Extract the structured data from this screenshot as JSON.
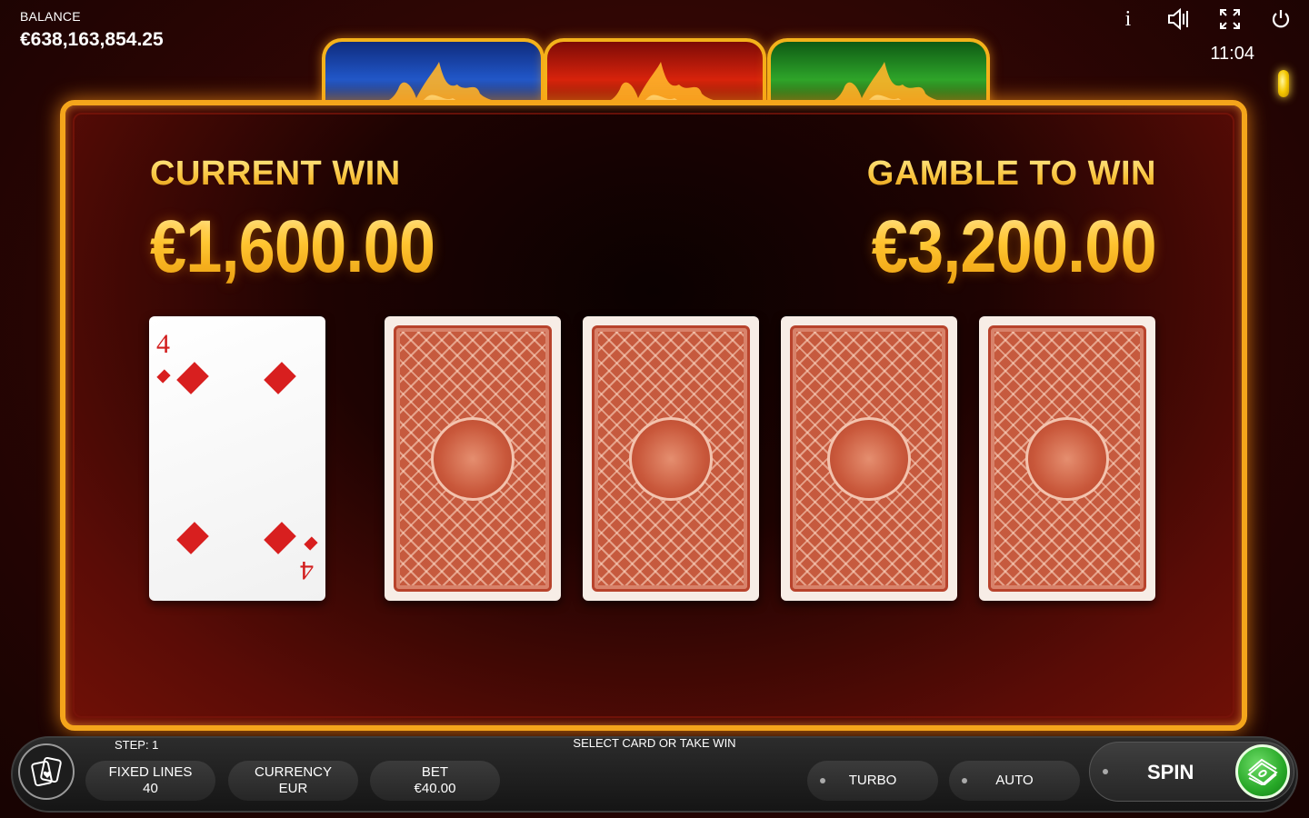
{
  "balance": {
    "label": "BALANCE",
    "value": "€638,163,854.25"
  },
  "topbar": {
    "icons": [
      "info-icon",
      "sound-icon",
      "fullscreen-icon",
      "power-icon"
    ],
    "info_glyph": "i",
    "clock": "11:04"
  },
  "gamble": {
    "current_win_label": "CURRENT WIN",
    "current_win_value": "€1,600.00",
    "gamble_label": "GAMBLE TO WIN",
    "gamble_value": "€3,200.00",
    "dealer_card": {
      "rank": "4",
      "suit": "diamonds"
    },
    "face_down_cards": 4
  },
  "bottom": {
    "step": "STEP: 1",
    "status": "SELECT CARD OR TAKE WIN",
    "fixed_lines_label": "FIXED LINES",
    "fixed_lines_value": "40",
    "currency_label": "CURRENCY",
    "currency_value": "EUR",
    "bet_label": "BET",
    "bet_value": "€40.00",
    "turbo": "TURBO",
    "auto": "AUTO",
    "spin": "SPIN"
  },
  "colors": {
    "gold": "#f4b21b",
    "panel_dark": "#1e0302",
    "card_back": "#c65a3e",
    "diamond_red": "#d81f1f",
    "spin_green": "#27a827"
  }
}
